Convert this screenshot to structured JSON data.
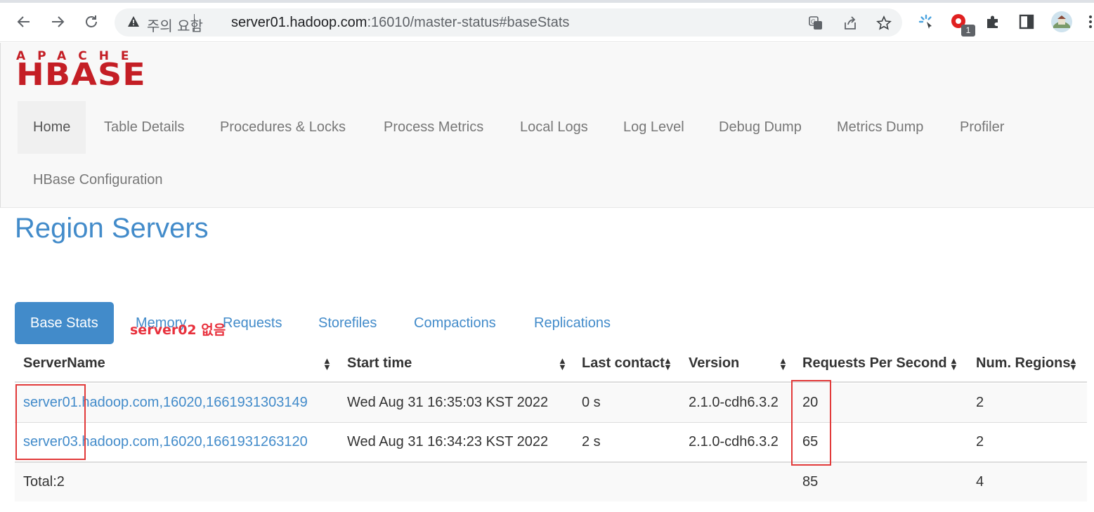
{
  "browser": {
    "security_label": "주의 요함",
    "url_host": "server01.hadoop.com",
    "url_rest": ":16010/master-status#baseStats",
    "extension_badge": "1"
  },
  "hbase": {
    "logo_top": "APACHE",
    "logo_main": "HBASE",
    "nav": [
      {
        "label": "Home"
      },
      {
        "label": "Table Details"
      },
      {
        "label": "Procedures & Locks"
      },
      {
        "label": "Process Metrics"
      },
      {
        "label": "Local Logs"
      },
      {
        "label": "Log Level"
      },
      {
        "label": "Debug Dump"
      },
      {
        "label": "Metrics Dump"
      },
      {
        "label": "Profiler"
      },
      {
        "label": "HBase Configuration"
      }
    ]
  },
  "region_servers": {
    "title": "Region Servers",
    "tabs": [
      {
        "label": "Base Stats"
      },
      {
        "label": "Memory"
      },
      {
        "label": "Requests"
      },
      {
        "label": "Storefiles"
      },
      {
        "label": "Compactions"
      },
      {
        "label": "Replications"
      }
    ],
    "columns": [
      "ServerName",
      "Start time",
      "Last contact",
      "Version",
      "Requests Per Second",
      "Num. Regions"
    ],
    "rows": [
      {
        "server": "server01.hadoop.com,16020,1661931303149",
        "start": "Wed Aug 31 16:35:03 KST 2022",
        "contact": "0 s",
        "version": "2.1.0-cdh6.3.2",
        "rps": "20",
        "regions": "2"
      },
      {
        "server": "server03.hadoop.com,16020,1661931263120",
        "start": "Wed Aug 31 16:34:23 KST 2022",
        "contact": "2 s",
        "version": "2.1.0-cdh6.3.2",
        "rps": "65",
        "regions": "2"
      }
    ],
    "total": {
      "label": "Total:2",
      "rps": "85",
      "regions": "4"
    }
  },
  "annotation": {
    "text": "server02 없음",
    "color": "#e8303c"
  },
  "colors": {
    "link": "#428bca",
    "logo": "#c41e25",
    "highlight": "#e23a3a"
  }
}
